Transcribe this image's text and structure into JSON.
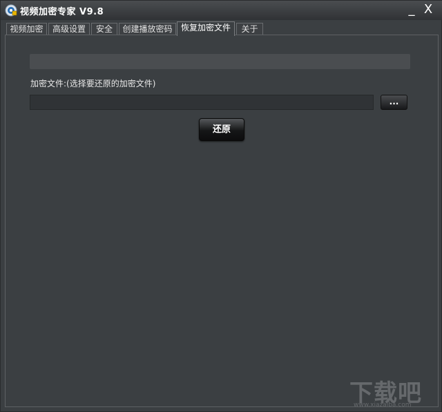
{
  "window": {
    "title": "视频加密专家 V9.8",
    "minimize_label": "_",
    "close_label": "X"
  },
  "tabs": [
    {
      "label": "视频加密"
    },
    {
      "label": "高级设置"
    },
    {
      "label": "安全"
    },
    {
      "label": "创建播放密码"
    },
    {
      "label": "恢复加密文件",
      "active": true
    },
    {
      "label": "关于"
    }
  ],
  "restore_panel": {
    "progress": 0,
    "file_label": "加密文件:(选择要还原的加密文件)",
    "file_path_value": "",
    "browse_label": "...",
    "restore_label": "还原"
  },
  "watermark": {
    "text": "下载吧",
    "sub": "www.xiazaiba.com"
  }
}
